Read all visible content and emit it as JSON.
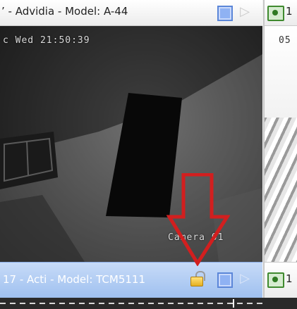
{
  "top_left_pane": {
    "title": "’ - Advidia - Model: A-44",
    "osd_timestamp": "c Wed 21:50:39"
  },
  "top_right_pane": {
    "title_fragment": "1",
    "osd_fragment": "05"
  },
  "bottom_left_pane": {
    "title": "17 - Acti - Model: TCM5111",
    "osd_camera_label": "Camera 01"
  },
  "bottom_right_pane": {
    "title_fragment": "1"
  },
  "icons": {
    "maximize": "square-icon",
    "forward": "arrow-right-icon",
    "camera": "camera-icon",
    "lock": "lock-icon",
    "annotation": "down-arrow-icon"
  },
  "colors": {
    "selected_titlebar": "#a9c6f2",
    "annotation_arrow": "#d21f1f",
    "maximize_button": "#8fb2f3"
  }
}
